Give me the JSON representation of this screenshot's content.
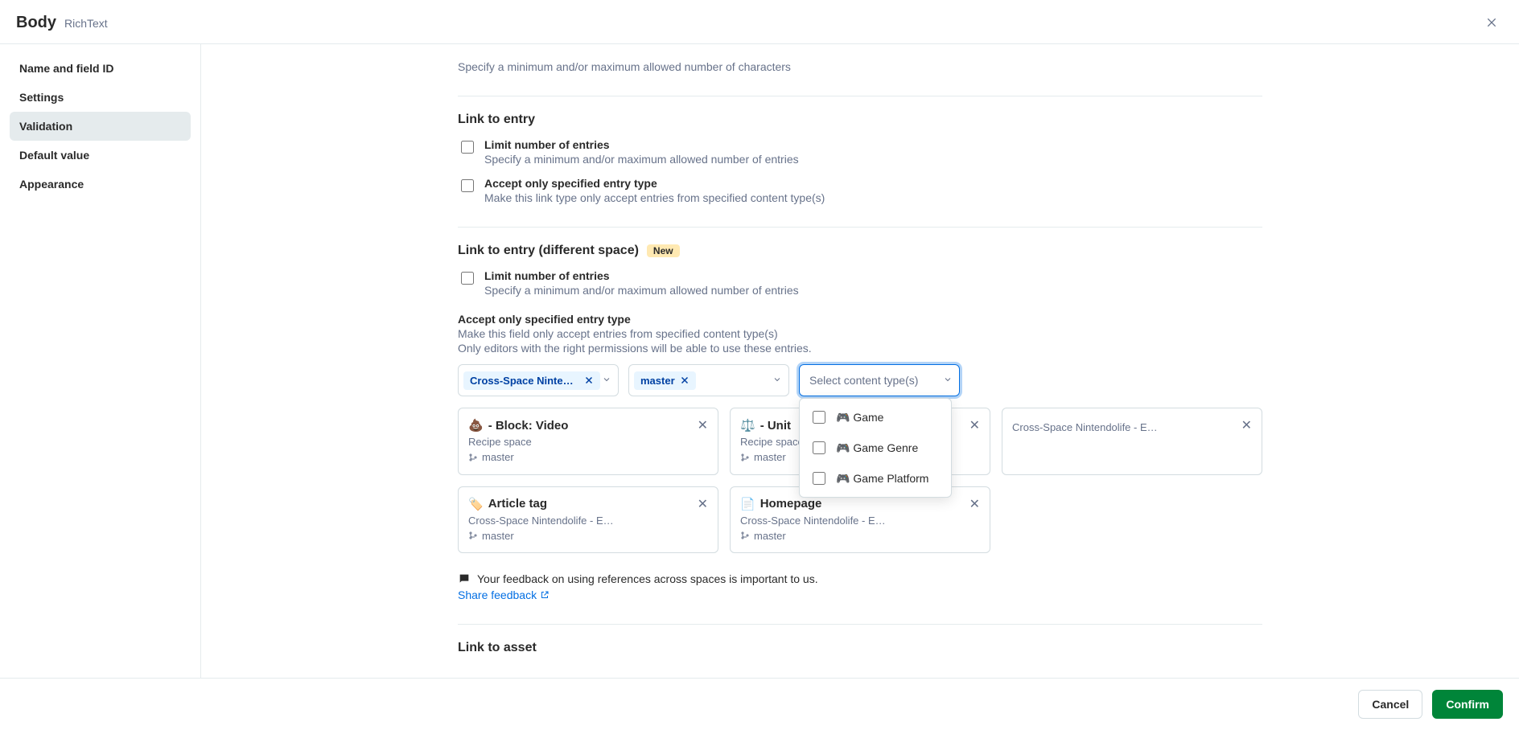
{
  "header": {
    "title": "Body",
    "field_kind": "RichText"
  },
  "sidebar": {
    "items": [
      {
        "label": "Name and field ID",
        "active": false
      },
      {
        "label": "Settings",
        "active": false
      },
      {
        "label": "Validation",
        "active": true
      },
      {
        "label": "Default value",
        "active": false
      },
      {
        "label": "Appearance",
        "active": false
      }
    ]
  },
  "top_help": "Specify a minimum and/or maximum allowed number of characters",
  "link_to_entry": {
    "title": "Link to entry",
    "limit_checkbox": {
      "label": "Limit number of entries",
      "description": "Specify a minimum and/or maximum allowed number of entries"
    },
    "accept_checkbox": {
      "label": "Accept only specified entry type",
      "description": "Make this link type only accept entries from specified content type(s)"
    }
  },
  "link_to_entry_diff": {
    "title": "Link to entry (different space)",
    "badge": "New",
    "limit_checkbox": {
      "label": "Limit number of entries",
      "description": "Specify a minimum and/or maximum allowed number of entries"
    },
    "accept_block": {
      "label": "Accept only specified entry type",
      "desc_line1": "Make this field only accept entries from specified content type(s)",
      "desc_line2": "Only editors with the right permissions will be able to use these entries."
    },
    "space_selector": {
      "value": "Cross-Space Nintendolife - E…"
    },
    "env_selector": {
      "value": "master"
    },
    "type_selector": {
      "placeholder": "Select content type(s)"
    },
    "dropdown_options": [
      {
        "label": "🎮 Game"
      },
      {
        "label": "🎮 Game Genre"
      },
      {
        "label": "🎮 Game Platform"
      }
    ],
    "cards": [
      {
        "emoji": "💩",
        "title": "- Block: Video",
        "subtitle": "Recipe space",
        "env": "master"
      },
      {
        "emoji": "⚖️",
        "title": "- Unit",
        "subtitle": "Recipe space",
        "env": "master"
      },
      {
        "emoji": "",
        "title": "",
        "subtitle": "Cross-Space Nintendolife - E…",
        "env": ""
      },
      {
        "emoji": "🏷️",
        "title": "Article tag",
        "subtitle": "Cross-Space Nintendolife - E…",
        "env": "master"
      },
      {
        "emoji": "📄",
        "title": "Homepage",
        "subtitle": "Cross-Space Nintendolife - E…",
        "env": "master"
      }
    ]
  },
  "feedback": {
    "text": "Your feedback on using references across spaces is important to us.",
    "share": "Share feedback"
  },
  "link_to_asset": {
    "title": "Link to asset"
  },
  "footer": {
    "cancel": "Cancel",
    "confirm": "Confirm"
  }
}
